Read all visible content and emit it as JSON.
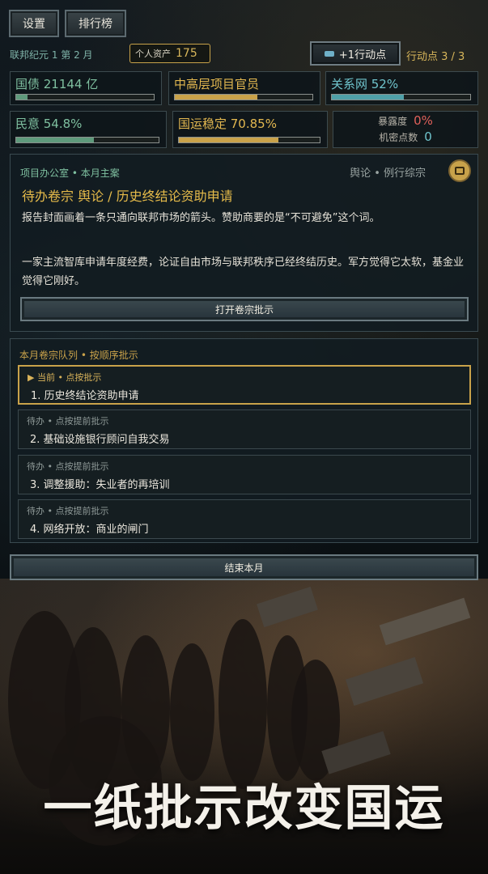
{
  "top_buttons": {
    "settings": "设置",
    "ranking": "排行榜"
  },
  "era": "联邦纪元 1 第 2 月",
  "assets": {
    "label": "个人资产",
    "value": "175"
  },
  "action_button": "+1行动点",
  "action_points": "行动点 3 / 3",
  "stats": {
    "debt": {
      "label": "国债 21144 亿",
      "fill": 0.08,
      "color": "#5f9a7c"
    },
    "rank": {
      "label": "中高层项目官员",
      "fill": 0.6,
      "color": "#c9a24a"
    },
    "network": {
      "label": "关系网 52%",
      "fill": 0.52,
      "color": "#4fa0a8"
    },
    "opinion": {
      "label": "民意 54.8%",
      "fill": 0.548,
      "color": "#5f9a7c"
    },
    "stability": {
      "label": "国运稳定 70.85%",
      "fill": 0.7085,
      "color": "#c9a24a"
    },
    "exposure": {
      "label": "暴露度",
      "value": "0%"
    },
    "secret": {
      "label": "机密点数",
      "value": "0"
    }
  },
  "case_panel": {
    "header": "项目办公室 • 本月主案",
    "meta": "舆论 • 例行综宗",
    "title": "待办卷宗 舆论 / 历史终结论资助申请",
    "para1": "报告封面画着一条只通向联邦市场的箭头。赞助商要的是“不可避免”这个词。",
    "para2": "一家主流智库申请年度经费，论证自由市场与联邦秩序已经终结历史。军方觉得它太软，基金业觉得它刚好。",
    "open_button": "打开卷宗批示"
  },
  "queue": {
    "header": "本月卷宗队列 • 按顺序批示",
    "items": [
      {
        "tag": "▶ 当前 • 点按批示",
        "title": "1. 历史终结论资助申请"
      },
      {
        "tag": "待办 • 点按提前批示",
        "title": "2. 基础设施银行顾问自我交易"
      },
      {
        "tag": "待办 • 点按提前批示",
        "title": "3. 调整援助：失业者的再培训"
      },
      {
        "tag": "待办 • 点按提前批示",
        "title": "4. 网络开放：商业的闸门"
      }
    ]
  },
  "end_month_button": "结束本月",
  "tagline": "一纸批示改变国运"
}
